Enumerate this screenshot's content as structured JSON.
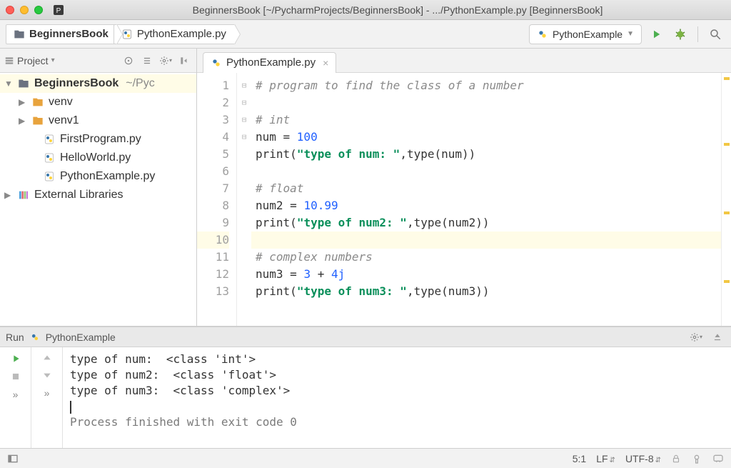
{
  "window": {
    "title": "BeginnersBook [~/PycharmProjects/BeginnersBook] - .../PythonExample.py [BeginnersBook]"
  },
  "breadcrumb": {
    "project": "BeginnersBook",
    "file": "PythonExample.py"
  },
  "toolbar": {
    "run_config": "PythonExample"
  },
  "sidebar": {
    "header_label": "Project",
    "project": {
      "name": "BeginnersBook",
      "path": "~/Pyc"
    },
    "items": [
      {
        "name": "venv",
        "type": "folder"
      },
      {
        "name": "venv1",
        "type": "folder"
      },
      {
        "name": "FirstProgram.py",
        "type": "py"
      },
      {
        "name": "HelloWorld.py",
        "type": "py"
      },
      {
        "name": "PythonExample.py",
        "type": "py"
      }
    ],
    "external_libs": "External Libraries"
  },
  "editor": {
    "tab_label": "PythonExample.py",
    "highlight_line": 10,
    "lines": [
      {
        "n": 1,
        "tokens": [
          [
            "cmt",
            "# program to find the class of a number"
          ]
        ]
      },
      {
        "n": 2,
        "tokens": []
      },
      {
        "n": 3,
        "tokens": [
          [
            "cmt",
            "# int"
          ]
        ]
      },
      {
        "n": 4,
        "tokens": [
          [
            "fn",
            "num "
          ],
          [
            "op",
            "= "
          ],
          [
            "num",
            "100"
          ]
        ]
      },
      {
        "n": 5,
        "tokens": [
          [
            "fn",
            "print"
          ],
          [
            "op",
            "("
          ],
          [
            "str",
            "\"type of num: \""
          ],
          [
            "op",
            ","
          ],
          [
            "fn",
            "type"
          ],
          [
            "op",
            "("
          ],
          [
            "fn",
            "num"
          ],
          [
            "op",
            "))"
          ]
        ]
      },
      {
        "n": 6,
        "tokens": []
      },
      {
        "n": 7,
        "tokens": [
          [
            "cmt",
            "# float"
          ]
        ]
      },
      {
        "n": 8,
        "tokens": [
          [
            "fn",
            "num2 "
          ],
          [
            "op",
            "= "
          ],
          [
            "num",
            "10.99"
          ]
        ]
      },
      {
        "n": 9,
        "tokens": [
          [
            "fn",
            "print"
          ],
          [
            "op",
            "("
          ],
          [
            "str",
            "\"type of num2: \""
          ],
          [
            "op",
            ","
          ],
          [
            "fn",
            "type"
          ],
          [
            "op",
            "("
          ],
          [
            "fn",
            "num2"
          ],
          [
            "op",
            "))"
          ]
        ]
      },
      {
        "n": 10,
        "tokens": []
      },
      {
        "n": 11,
        "tokens": [
          [
            "cmt",
            "# complex numbers"
          ]
        ]
      },
      {
        "n": 12,
        "tokens": [
          [
            "fn",
            "num3 "
          ],
          [
            "op",
            "= "
          ],
          [
            "num",
            "3"
          ],
          [
            "fn",
            " + "
          ],
          [
            "num",
            "4j"
          ]
        ]
      },
      {
        "n": 13,
        "tokens": [
          [
            "fn",
            "print"
          ],
          [
            "op",
            "("
          ],
          [
            "str",
            "\"type of num3: \""
          ],
          [
            "op",
            ","
          ],
          [
            "fn",
            "type"
          ],
          [
            "op",
            "("
          ],
          [
            "fn",
            "num3"
          ],
          [
            "op",
            "))"
          ]
        ]
      }
    ]
  },
  "run": {
    "header": "Run",
    "config": "PythonExample",
    "output": [
      "type of num:  <class 'int'>",
      "type of num2:  <class 'float'>",
      "type of num3:  <class 'complex'>"
    ],
    "exit": "Process finished with exit code 0"
  },
  "status": {
    "pos": "5:1",
    "lf": "LF",
    "enc": "UTF-8"
  }
}
